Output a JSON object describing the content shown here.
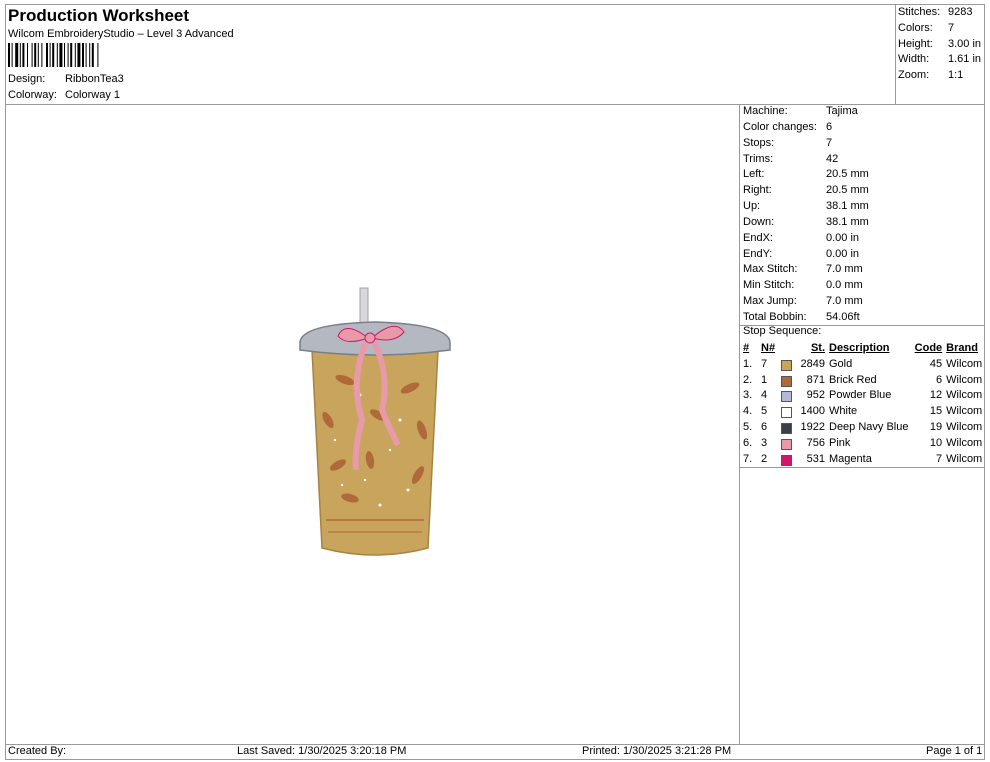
{
  "header": {
    "title": "Production Worksheet",
    "software": "Wilcom EmbroideryStudio – Level 3 Advanced",
    "design_label": "Design:",
    "design_value": "RibbonTea3",
    "colorway_label": "Colorway:",
    "colorway_value": "Colorway 1"
  },
  "summary": [
    {
      "label": "Stitches:",
      "value": "9283"
    },
    {
      "label": "Colors:",
      "value": "7"
    },
    {
      "label": "Height:",
      "value": "3.00 in"
    },
    {
      "label": "Width:",
      "value": "1.61 in"
    },
    {
      "label": "Zoom:",
      "value": "1:1"
    }
  ],
  "specs": [
    {
      "label": "Machine:",
      "value": "Tajima"
    },
    {
      "label": "Color changes:",
      "value": "6"
    },
    {
      "label": "Stops:",
      "value": "7"
    },
    {
      "label": "Trims:",
      "value": "42"
    },
    {
      "label": "Left:",
      "value": "20.5 mm"
    },
    {
      "label": "Right:",
      "value": "20.5 mm"
    },
    {
      "label": "Up:",
      "value": "38.1 mm"
    },
    {
      "label": "Down:",
      "value": "38.1 mm"
    },
    {
      "label": "EndX:",
      "value": "0.00 in"
    },
    {
      "label": "EndY:",
      "value": "0.00 in"
    },
    {
      "label": "Max Stitch:",
      "value": "7.0 mm"
    },
    {
      "label": "Min Stitch:",
      "value": "0.0 mm"
    },
    {
      "label": "Max Jump:",
      "value": "7.0 mm"
    },
    {
      "label": "Total Bobbin:",
      "value": "54.06ft"
    }
  ],
  "stop_sequence": {
    "title": "Stop Sequence:",
    "headers": {
      "num": "#",
      "n": "N#",
      "st": "St.",
      "desc": "Description",
      "code": "Code",
      "brand": "Brand"
    },
    "rows": [
      {
        "num": "1.",
        "n": "7",
        "st": "2849",
        "desc": "Gold",
        "code": "45",
        "brand": "Wilcom",
        "color": "#c8a45c"
      },
      {
        "num": "2.",
        "n": "1",
        "st": "871",
        "desc": "Brick Red",
        "code": "6",
        "brand": "Wilcom",
        "color": "#b06a3a"
      },
      {
        "num": "3.",
        "n": "4",
        "st": "952",
        "desc": "Powder Blue",
        "code": "12",
        "brand": "Wilcom",
        "color": "#b4b8d8"
      },
      {
        "num": "4.",
        "n": "5",
        "st": "1400",
        "desc": "White",
        "code": "15",
        "brand": "Wilcom",
        "color": "#ffffff"
      },
      {
        "num": "5.",
        "n": "6",
        "st": "1922",
        "desc": "Deep Navy Blue",
        "code": "19",
        "brand": "Wilcom",
        "color": "#3a3e48"
      },
      {
        "num": "6.",
        "n": "3",
        "st": "756",
        "desc": "Pink",
        "code": "10",
        "brand": "Wilcom",
        "color": "#e89aa8"
      },
      {
        "num": "7.",
        "n": "2",
        "st": "531",
        "desc": "Magenta",
        "code": "7",
        "brand": "Wilcom",
        "color": "#d0186a"
      }
    ]
  },
  "footer": {
    "created_by": "Created By:",
    "last_saved": "Last Saved: 1/30/2025 3:20:18 PM",
    "printed": "Printed: 1/30/2025 3:21:28 PM",
    "page": "Page 1 of 1"
  }
}
